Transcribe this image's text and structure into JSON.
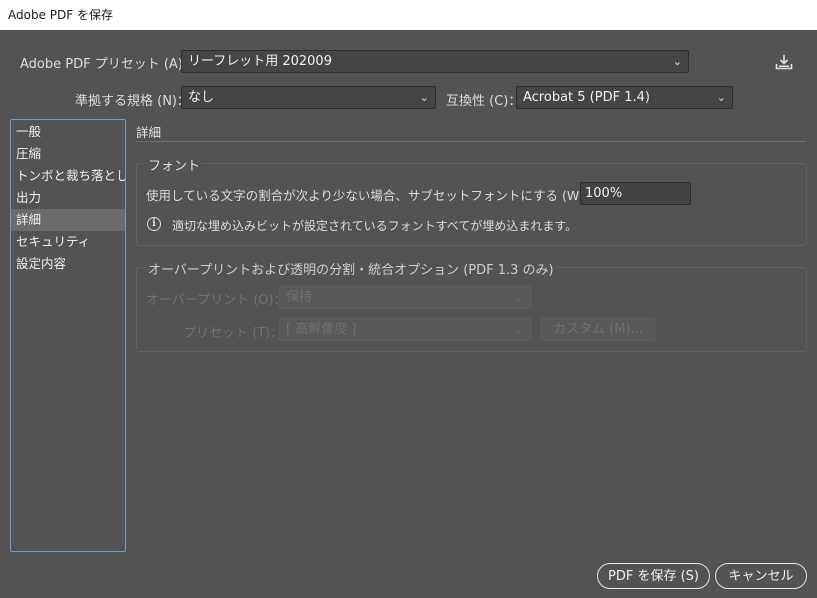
{
  "window": {
    "title": "Adobe PDF を保存"
  },
  "preset": {
    "label": "Adobe PDF プリセット (A)：",
    "value": "リーフレット用 202009"
  },
  "standard": {
    "label": "準拠する規格 (N)：",
    "value": "なし"
  },
  "compat": {
    "label": "互換性 (C)：",
    "value": "Acrobat 5 (PDF 1.4)"
  },
  "icons": {
    "save_preset": "download-icon",
    "dropdown": "chevron-down-icon",
    "info": "info-icon"
  },
  "sidebar": {
    "items": [
      {
        "label": "一般"
      },
      {
        "label": "圧縮"
      },
      {
        "label": "トンボと裁ち落とし"
      },
      {
        "label": "出力"
      },
      {
        "label": "詳細"
      },
      {
        "label": "セキュリティ"
      },
      {
        "label": "設定内容"
      }
    ],
    "selected_index": 4
  },
  "main": {
    "section_title": "詳細",
    "fonts": {
      "title": "フォント",
      "subset_label": "使用している文字の割合が次より少ない場合、サブセットフォントにする (W)：",
      "subset_value": "100%",
      "info_text": "適切な埋め込みビットが設定されているフォントすべてが埋め込まれます。"
    },
    "overprint": {
      "title": "オーバープリントおよび透明の分割・統合オプション (PDF 1.3 のみ)",
      "overprint_label": "オーバープリント (O)：",
      "overprint_value": "保持",
      "preset_label": "プリセット (T)：",
      "preset_value": "[ 高解像度 ]",
      "custom_button": "カスタム (M)..."
    }
  },
  "footer": {
    "save_button": "PDF を保存 (S)",
    "cancel_button": "キャンセル"
  }
}
